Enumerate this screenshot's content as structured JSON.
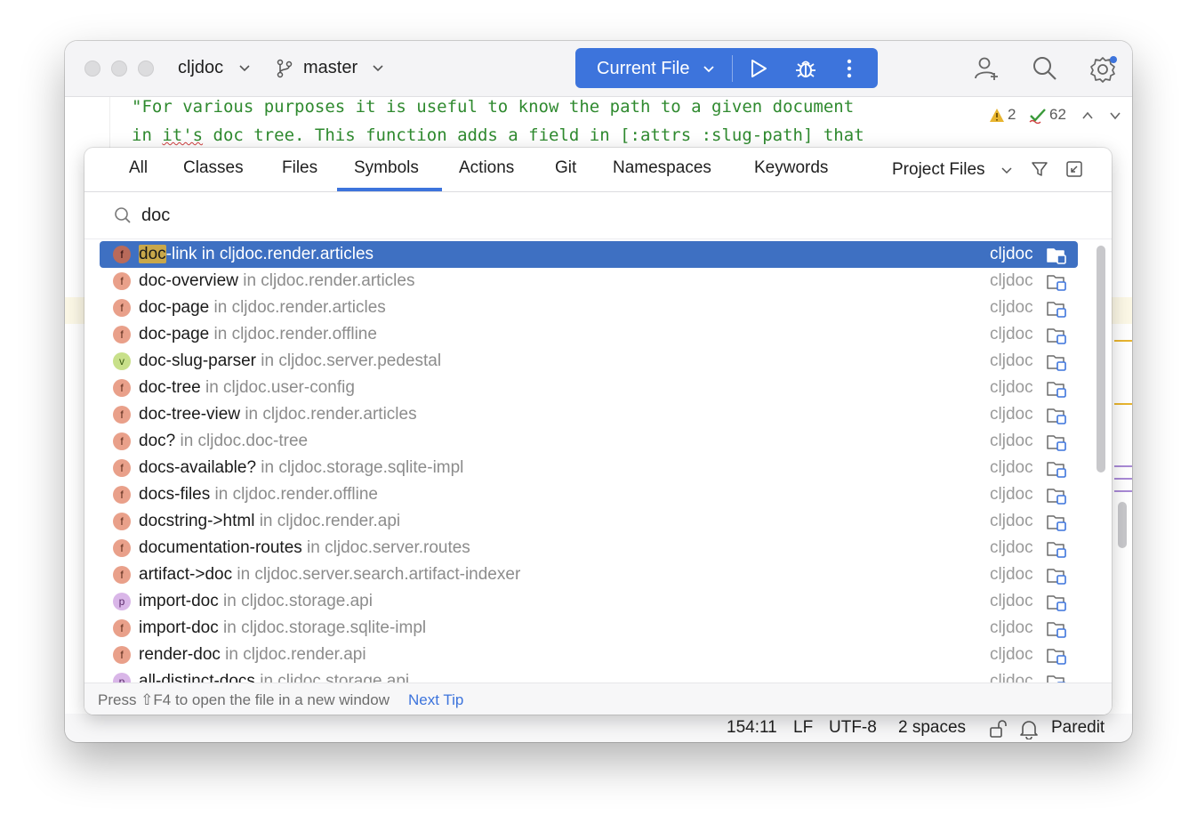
{
  "titlebar": {
    "project": "cljdoc",
    "branch": "master",
    "run_config": "Current File"
  },
  "editor": {
    "code_line_1": "\"For various purposes it is useful to know the path to a given document",
    "code_line_2_prefix": "in ",
    "code_line_2_squiggle": "it's",
    "code_line_2_suffix": " doc tree. This function adds a field in [:attrs :slug-path] that",
    "warnings_count": "2",
    "checks_count": "62"
  },
  "search_popup": {
    "tabs": [
      "All",
      "Classes",
      "Files",
      "Symbols",
      "Actions",
      "Git",
      "Namespaces",
      "Keywords"
    ],
    "active_tab": "Symbols",
    "scope": "Project Files",
    "query": "doc",
    "results": [
      {
        "kind": "f",
        "match": "doc",
        "rest": "-link",
        "location": " in cljdoc.render.articles",
        "project": "cljdoc",
        "selected": true
      },
      {
        "kind": "f",
        "name": "doc-overview",
        "location": " in cljdoc.render.articles",
        "project": "cljdoc"
      },
      {
        "kind": "f",
        "name": "doc-page",
        "location": " in cljdoc.render.articles",
        "project": "cljdoc"
      },
      {
        "kind": "f",
        "name": "doc-page",
        "location": " in cljdoc.render.offline",
        "project": "cljdoc"
      },
      {
        "kind": "v",
        "name": "doc-slug-parser",
        "location": " in cljdoc.server.pedestal",
        "project": "cljdoc"
      },
      {
        "kind": "f",
        "name": "doc-tree",
        "location": " in cljdoc.user-config",
        "project": "cljdoc"
      },
      {
        "kind": "f",
        "name": "doc-tree-view",
        "location": " in cljdoc.render.articles",
        "project": "cljdoc"
      },
      {
        "kind": "f",
        "name": "doc?",
        "location": " in cljdoc.doc-tree",
        "project": "cljdoc"
      },
      {
        "kind": "f",
        "name": "docs-available?",
        "location": " in cljdoc.storage.sqlite-impl",
        "project": "cljdoc"
      },
      {
        "kind": "f",
        "name": "docs-files",
        "location": " in cljdoc.render.offline",
        "project": "cljdoc"
      },
      {
        "kind": "f",
        "name": "docstring->html",
        "location": " in cljdoc.render.api",
        "project": "cljdoc"
      },
      {
        "kind": "f",
        "name": "documentation-routes",
        "location": " in cljdoc.server.routes",
        "project": "cljdoc"
      },
      {
        "kind": "f",
        "name": "artifact->doc",
        "location": " in cljdoc.server.search.artifact-indexer",
        "project": "cljdoc"
      },
      {
        "kind": "p",
        "name": "import-doc",
        "location": " in cljdoc.storage.api",
        "project": "cljdoc"
      },
      {
        "kind": "f",
        "name": "import-doc",
        "location": " in cljdoc.storage.sqlite-impl",
        "project": "cljdoc"
      },
      {
        "kind": "f",
        "name": "render-doc",
        "location": " in cljdoc.render.api",
        "project": "cljdoc"
      },
      {
        "kind": "p",
        "name": "all-distinct-docs",
        "location": " in cljdoc.storage.api",
        "project": "cljdoc"
      }
    ],
    "footer_tip": "Press ⇧F4 to open the file in a new window",
    "footer_link": "Next Tip"
  },
  "statusbar": {
    "position": "154:11",
    "line_sep": "LF",
    "encoding": "UTF-8",
    "indent": "2 spaces",
    "mode": "Paredit"
  },
  "colors": {
    "accent": "#3d74dc",
    "selection": "#3e70c2",
    "code_string": "#2f8a2f"
  }
}
